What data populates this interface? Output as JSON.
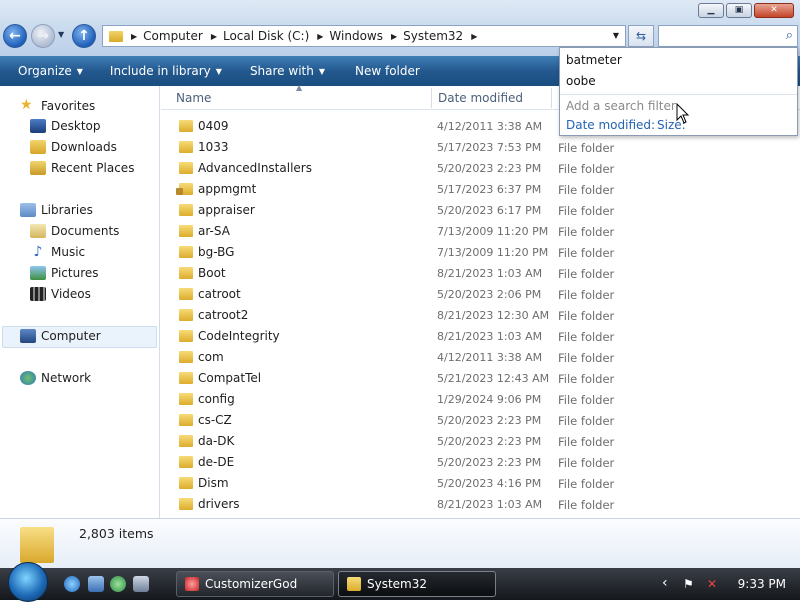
{
  "window": {
    "minimize_glyph": "▁",
    "maximize_glyph": "▣",
    "close_glyph": "✕"
  },
  "nav": {
    "back_glyph": "←",
    "forward_glyph": "→",
    "up_glyph": "↑"
  },
  "address": {
    "crumbs": [
      "Computer",
      "Local Disk (C:)",
      "Windows",
      "System32"
    ],
    "search_value": ""
  },
  "toolbar": {
    "organize": "Organize",
    "include_in_library": "Include in library",
    "share_with": "Share with",
    "new_folder": "New folder"
  },
  "navpane": {
    "favorites": "Favorites",
    "desktop": "Desktop",
    "downloads": "Downloads",
    "recent_places": "Recent Places",
    "libraries": "Libraries",
    "documents": "Documents",
    "music": "Music",
    "pictures": "Pictures",
    "videos": "Videos",
    "computer": "Computer",
    "network": "Network"
  },
  "columns": {
    "name": "Name",
    "date_modified": "Date modified"
  },
  "files": [
    {
      "name": "0409",
      "date": "4/12/2011 3:38 AM",
      "type": "File folder"
    },
    {
      "name": "1033",
      "date": "5/17/2023 7:53 PM",
      "type": "File folder"
    },
    {
      "name": "AdvancedInstallers",
      "date": "5/20/2023 2:23 PM",
      "type": "File folder"
    },
    {
      "name": "appmgmt",
      "date": "5/17/2023 6:37 PM",
      "type": "File folder"
    },
    {
      "name": "appraiser",
      "date": "5/20/2023 6:17 PM",
      "type": "File folder"
    },
    {
      "name": "ar-SA",
      "date": "7/13/2009 11:20 PM",
      "type": "File folder"
    },
    {
      "name": "bg-BG",
      "date": "7/13/2009 11:20 PM",
      "type": "File folder"
    },
    {
      "name": "Boot",
      "date": "8/21/2023 1:03 AM",
      "type": "File folder"
    },
    {
      "name": "catroot",
      "date": "5/20/2023 2:06 PM",
      "type": "File folder"
    },
    {
      "name": "catroot2",
      "date": "8/21/2023 12:30 AM",
      "type": "File folder"
    },
    {
      "name": "CodeIntegrity",
      "date": "8/21/2023 1:03 AM",
      "type": "File folder"
    },
    {
      "name": "com",
      "date": "4/12/2011 3:38 AM",
      "type": "File folder"
    },
    {
      "name": "CompatTel",
      "date": "5/21/2023 12:43 AM",
      "type": "File folder"
    },
    {
      "name": "config",
      "date": "1/29/2024 9:06 PM",
      "type": "File folder"
    },
    {
      "name": "cs-CZ",
      "date": "5/20/2023 2:23 PM",
      "type": "File folder"
    },
    {
      "name": "da-DK",
      "date": "5/20/2023 2:23 PM",
      "type": "File folder"
    },
    {
      "name": "de-DE",
      "date": "5/20/2023 2:23 PM",
      "type": "File folder"
    },
    {
      "name": "Dism",
      "date": "5/20/2023 4:16 PM",
      "type": "File folder"
    },
    {
      "name": "drivers",
      "date": "8/21/2023 1:03 AM",
      "type": "File folder"
    }
  ],
  "search_dropdown": {
    "suggestions": [
      "batmeter",
      "oobe"
    ],
    "filter_hint": "Add a search filter",
    "filter_date": "Date modified:",
    "filter_size": "Size:"
  },
  "details": {
    "item_count": "2,803 items"
  },
  "taskbar": {
    "tasks": [
      "CustomizerGod",
      "System32"
    ],
    "tray_chevron": "‹",
    "clock": "9:33 PM"
  }
}
